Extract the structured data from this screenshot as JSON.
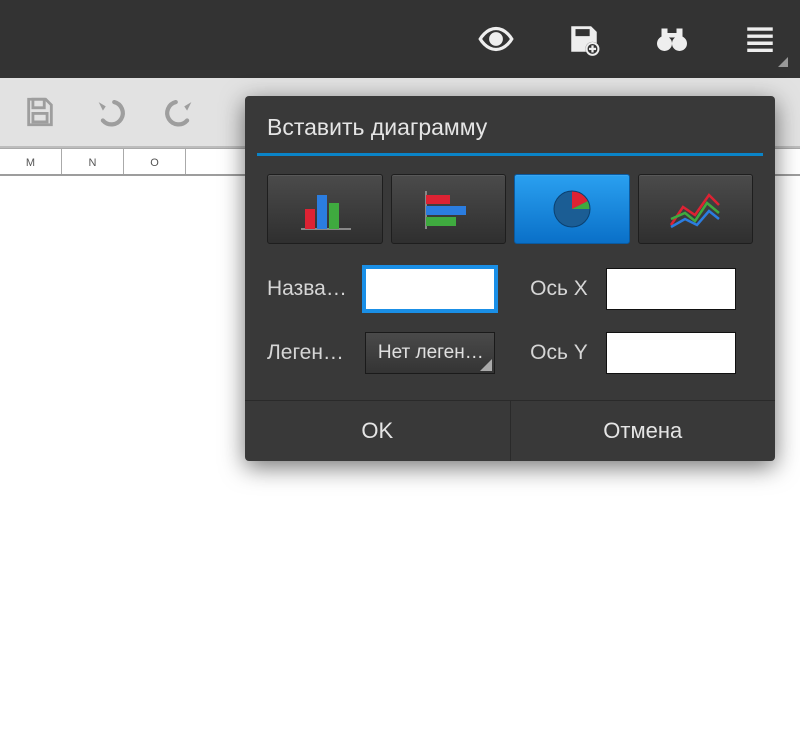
{
  "columns": [
    "M",
    "N",
    "O"
  ],
  "dialog": {
    "title": "Вставить диаграмму",
    "chart_types": [
      "bar",
      "horizontal-bar",
      "pie",
      "line"
    ],
    "selected_type_index": 2,
    "name_label": "Назва…",
    "name_value": "",
    "legend_label": "Леген…",
    "legend_value": "Нет леген…",
    "axisx_label": "Ось X",
    "axisx_value": "",
    "axisy_label": "Ось Y",
    "axisy_value": "",
    "ok_label": "OK",
    "cancel_label": "Отмена"
  }
}
